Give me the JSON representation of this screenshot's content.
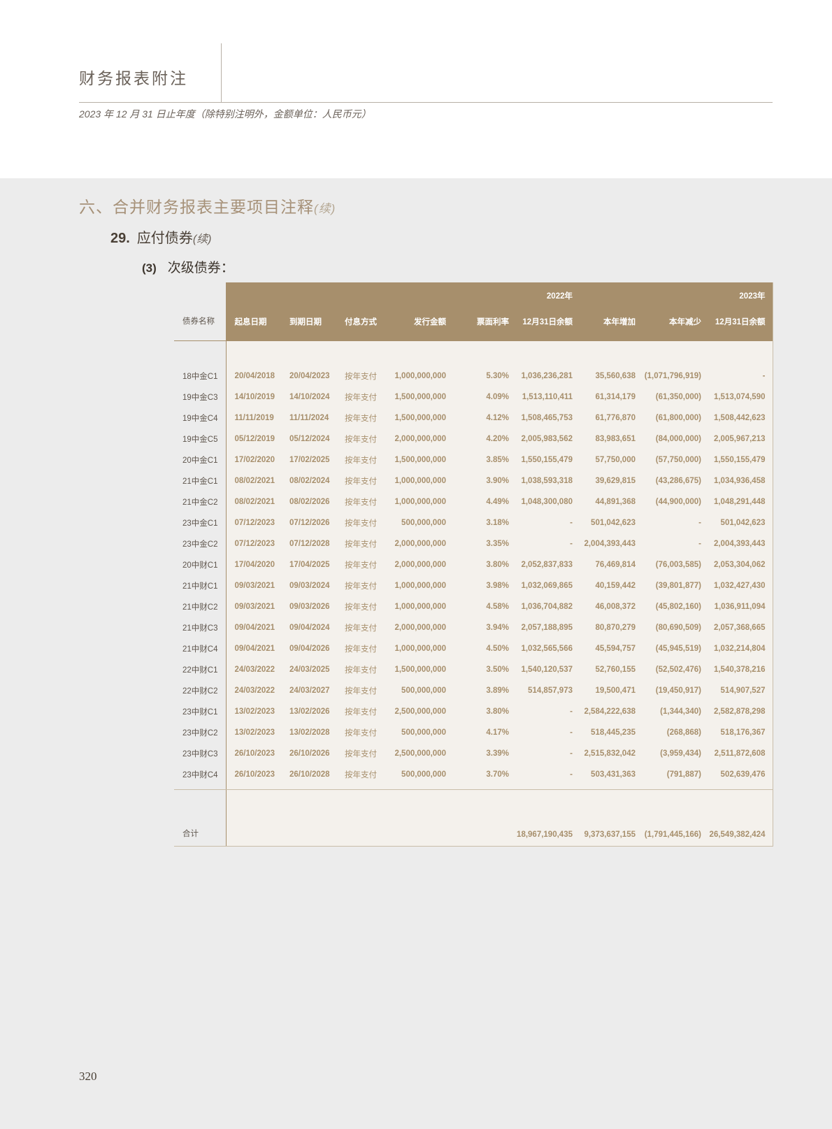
{
  "header": {
    "doc_title": "财务报表附注",
    "subtitle": "2023 年 12 月 31 日止年度（除特别注明外，金额单位：人民币元）"
  },
  "section": {
    "title": "六、合并财务报表主要项目注释",
    "title_cont": "(续)",
    "sub_num": "29.",
    "sub_title": "应付债券",
    "sub_cont": "(续)",
    "subsub_num": "(3)",
    "subsub_title": "次级债券："
  },
  "table": {
    "headers": {
      "name": "债券名称",
      "start": "起息日期",
      "maturity": "到期日期",
      "method": "付息方式",
      "amount": "发行金额",
      "rate": "票面利率",
      "bal2022_year": "2022年",
      "bal2022": "12月31日余额",
      "increase": "本年增加",
      "decrease": "本年减少",
      "bal2023_year": "2023年",
      "bal2023": "12月31日余额"
    },
    "rows": [
      {
        "name": "18中金C1",
        "start": "20/04/2018",
        "maturity": "20/04/2023",
        "method": "按年支付",
        "amount": "1,000,000,000",
        "rate": "5.30%",
        "bal2022": "1,036,236,281",
        "increase": "35,560,638",
        "decrease": "(1,071,796,919)",
        "bal2023": "-"
      },
      {
        "name": "19中金C3",
        "start": "14/10/2019",
        "maturity": "14/10/2024",
        "method": "按年支付",
        "amount": "1,500,000,000",
        "rate": "4.09%",
        "bal2022": "1,513,110,411",
        "increase": "61,314,179",
        "decrease": "(61,350,000)",
        "bal2023": "1,513,074,590"
      },
      {
        "name": "19中金C4",
        "start": "11/11/2019",
        "maturity": "11/11/2024",
        "method": "按年支付",
        "amount": "1,500,000,000",
        "rate": "4.12%",
        "bal2022": "1,508,465,753",
        "increase": "61,776,870",
        "decrease": "(61,800,000)",
        "bal2023": "1,508,442,623"
      },
      {
        "name": "19中金C5",
        "start": "05/12/2019",
        "maturity": "05/12/2024",
        "method": "按年支付",
        "amount": "2,000,000,000",
        "rate": "4.20%",
        "bal2022": "2,005,983,562",
        "increase": "83,983,651",
        "decrease": "(84,000,000)",
        "bal2023": "2,005,967,213"
      },
      {
        "name": "20中金C1",
        "start": "17/02/2020",
        "maturity": "17/02/2025",
        "method": "按年支付",
        "amount": "1,500,000,000",
        "rate": "3.85%",
        "bal2022": "1,550,155,479",
        "increase": "57,750,000",
        "decrease": "(57,750,000)",
        "bal2023": "1,550,155,479"
      },
      {
        "name": "21中金C1",
        "start": "08/02/2021",
        "maturity": "08/02/2024",
        "method": "按年支付",
        "amount": "1,000,000,000",
        "rate": "3.90%",
        "bal2022": "1,038,593,318",
        "increase": "39,629,815",
        "decrease": "(43,286,675)",
        "bal2023": "1,034,936,458"
      },
      {
        "name": "21中金C2",
        "start": "08/02/2021",
        "maturity": "08/02/2026",
        "method": "按年支付",
        "amount": "1,000,000,000",
        "rate": "4.49%",
        "bal2022": "1,048,300,080",
        "increase": "44,891,368",
        "decrease": "(44,900,000)",
        "bal2023": "1,048,291,448"
      },
      {
        "name": "23中金C1",
        "start": "07/12/2023",
        "maturity": "07/12/2026",
        "method": "按年支付",
        "amount": "500,000,000",
        "rate": "3.18%",
        "bal2022": "-",
        "increase": "501,042,623",
        "decrease": "-",
        "bal2023": "501,042,623"
      },
      {
        "name": "23中金C2",
        "start": "07/12/2023",
        "maturity": "07/12/2028",
        "method": "按年支付",
        "amount": "2,000,000,000",
        "rate": "3.35%",
        "bal2022": "-",
        "increase": "2,004,393,443",
        "decrease": "-",
        "bal2023": "2,004,393,443"
      },
      {
        "name": "20中财C1",
        "start": "17/04/2020",
        "maturity": "17/04/2025",
        "method": "按年支付",
        "amount": "2,000,000,000",
        "rate": "3.80%",
        "bal2022": "2,052,837,833",
        "increase": "76,469,814",
        "decrease": "(76,003,585)",
        "bal2023": "2,053,304,062"
      },
      {
        "name": "21中财C1",
        "start": "09/03/2021",
        "maturity": "09/03/2024",
        "method": "按年支付",
        "amount": "1,000,000,000",
        "rate": "3.98%",
        "bal2022": "1,032,069,865",
        "increase": "40,159,442",
        "decrease": "(39,801,877)",
        "bal2023": "1,032,427,430"
      },
      {
        "name": "21中财C2",
        "start": "09/03/2021",
        "maturity": "09/03/2026",
        "method": "按年支付",
        "amount": "1,000,000,000",
        "rate": "4.58%",
        "bal2022": "1,036,704,882",
        "increase": "46,008,372",
        "decrease": "(45,802,160)",
        "bal2023": "1,036,911,094"
      },
      {
        "name": "21中财C3",
        "start": "09/04/2021",
        "maturity": "09/04/2024",
        "method": "按年支付",
        "amount": "2,000,000,000",
        "rate": "3.94%",
        "bal2022": "2,057,188,895",
        "increase": "80,870,279",
        "decrease": "(80,690,509)",
        "bal2023": "2,057,368,665"
      },
      {
        "name": "21中财C4",
        "start": "09/04/2021",
        "maturity": "09/04/2026",
        "method": "按年支付",
        "amount": "1,000,000,000",
        "rate": "4.50%",
        "bal2022": "1,032,565,566",
        "increase": "45,594,757",
        "decrease": "(45,945,519)",
        "bal2023": "1,032,214,804"
      },
      {
        "name": "22中财C1",
        "start": "24/03/2022",
        "maturity": "24/03/2025",
        "method": "按年支付",
        "amount": "1,500,000,000",
        "rate": "3.50%",
        "bal2022": "1,540,120,537",
        "increase": "52,760,155",
        "decrease": "(52,502,476)",
        "bal2023": "1,540,378,216"
      },
      {
        "name": "22中财C2",
        "start": "24/03/2022",
        "maturity": "24/03/2027",
        "method": "按年支付",
        "amount": "500,000,000",
        "rate": "3.89%",
        "bal2022": "514,857,973",
        "increase": "19,500,471",
        "decrease": "(19,450,917)",
        "bal2023": "514,907,527"
      },
      {
        "name": "23中财C1",
        "start": "13/02/2023",
        "maturity": "13/02/2026",
        "method": "按年支付",
        "amount": "2,500,000,000",
        "rate": "3.80%",
        "bal2022": "-",
        "increase": "2,584,222,638",
        "decrease": "(1,344,340)",
        "bal2023": "2,582,878,298"
      },
      {
        "name": "23中财C2",
        "start": "13/02/2023",
        "maturity": "13/02/2028",
        "method": "按年支付",
        "amount": "500,000,000",
        "rate": "4.17%",
        "bal2022": "-",
        "increase": "518,445,235",
        "decrease": "(268,868)",
        "bal2023": "518,176,367"
      },
      {
        "name": "23中财C3",
        "start": "26/10/2023",
        "maturity": "26/10/2026",
        "method": "按年支付",
        "amount": "2,500,000,000",
        "rate": "3.39%",
        "bal2022": "-",
        "increase": "2,515,832,042",
        "decrease": "(3,959,434)",
        "bal2023": "2,511,872,608"
      },
      {
        "name": "23中财C4",
        "start": "26/10/2023",
        "maturity": "26/10/2028",
        "method": "按年支付",
        "amount": "500,000,000",
        "rate": "3.70%",
        "bal2022": "-",
        "increase": "503,431,363",
        "decrease": "(791,887)",
        "bal2023": "502,639,476"
      }
    ],
    "total": {
      "label": "合计",
      "bal2022": "18,967,190,435",
      "increase": "9,373,637,155",
      "decrease": "(1,791,445,166)",
      "bal2023": "26,549,382,424"
    }
  },
  "footer": {
    "page_number": "320"
  }
}
